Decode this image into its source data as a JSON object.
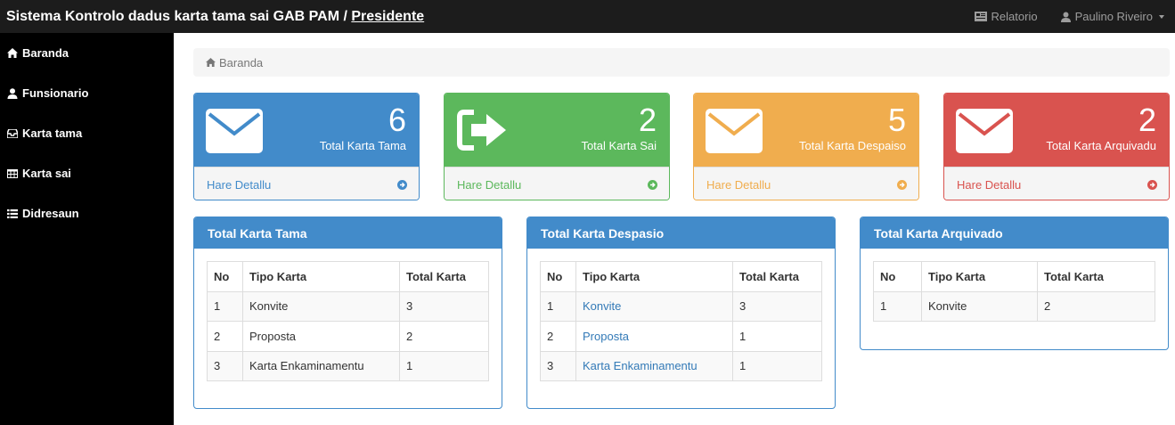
{
  "header": {
    "title": "Sistema Kontrolo dadus karta tama sai GAB PAM /",
    "role": "Presidente",
    "report_label": "Relatorio",
    "user_label": "Paulino Riveiro"
  },
  "sidebar": {
    "items": [
      {
        "label": "Baranda",
        "icon": "home-icon"
      },
      {
        "label": "Funsionario",
        "icon": "user-icon"
      },
      {
        "label": "Karta tama",
        "icon": "inbox-icon"
      },
      {
        "label": "Karta sai",
        "icon": "table-icon"
      },
      {
        "label": "Didresaun",
        "icon": "list-icon"
      }
    ]
  },
  "breadcrumb": {
    "label": "Baranda"
  },
  "cards": [
    {
      "count": "6",
      "label": "Total Karta Tama",
      "footer": "Hare Detallu",
      "color": "#428bca",
      "icon": "envelope-icon"
    },
    {
      "count": "2",
      "label": "Total Karta Sai",
      "footer": "Hare Detallu",
      "color": "#5cb85c",
      "icon": "sign-out-icon"
    },
    {
      "count": "5",
      "label": "Total Karta Despaiso",
      "footer": "Hare Detallu",
      "color": "#f0ad4e",
      "icon": "envelope-icon"
    },
    {
      "count": "2",
      "label": "Total Karta Arquivadu",
      "footer": "Hare Detallu",
      "color": "#d9534f",
      "icon": "envelope-icon"
    }
  ],
  "panels": [
    {
      "title": "Total Karta Tama",
      "columns": [
        "No",
        "Tipo Karta",
        "Total Karta"
      ],
      "rows": [
        [
          "1",
          "Konvite",
          "3"
        ],
        [
          "2",
          "Proposta",
          "2"
        ],
        [
          "3",
          "Karta Enkaminamentu",
          "1"
        ]
      ]
    },
    {
      "title": "Total Karta Despasio",
      "columns": [
        "No",
        "Tipo Karta",
        "Total Karta"
      ],
      "rows": [
        [
          "1",
          "Konvite",
          "3"
        ],
        [
          "2",
          "Proposta",
          "1"
        ],
        [
          "3",
          "Karta Enkaminamentu",
          "1"
        ]
      ]
    },
    {
      "title": "Total Karta Arquivado",
      "columns": [
        "No",
        "Tipo Karta",
        "Total Karta"
      ],
      "rows": [
        [
          "1",
          "Konvite",
          "2"
        ]
      ]
    }
  ]
}
